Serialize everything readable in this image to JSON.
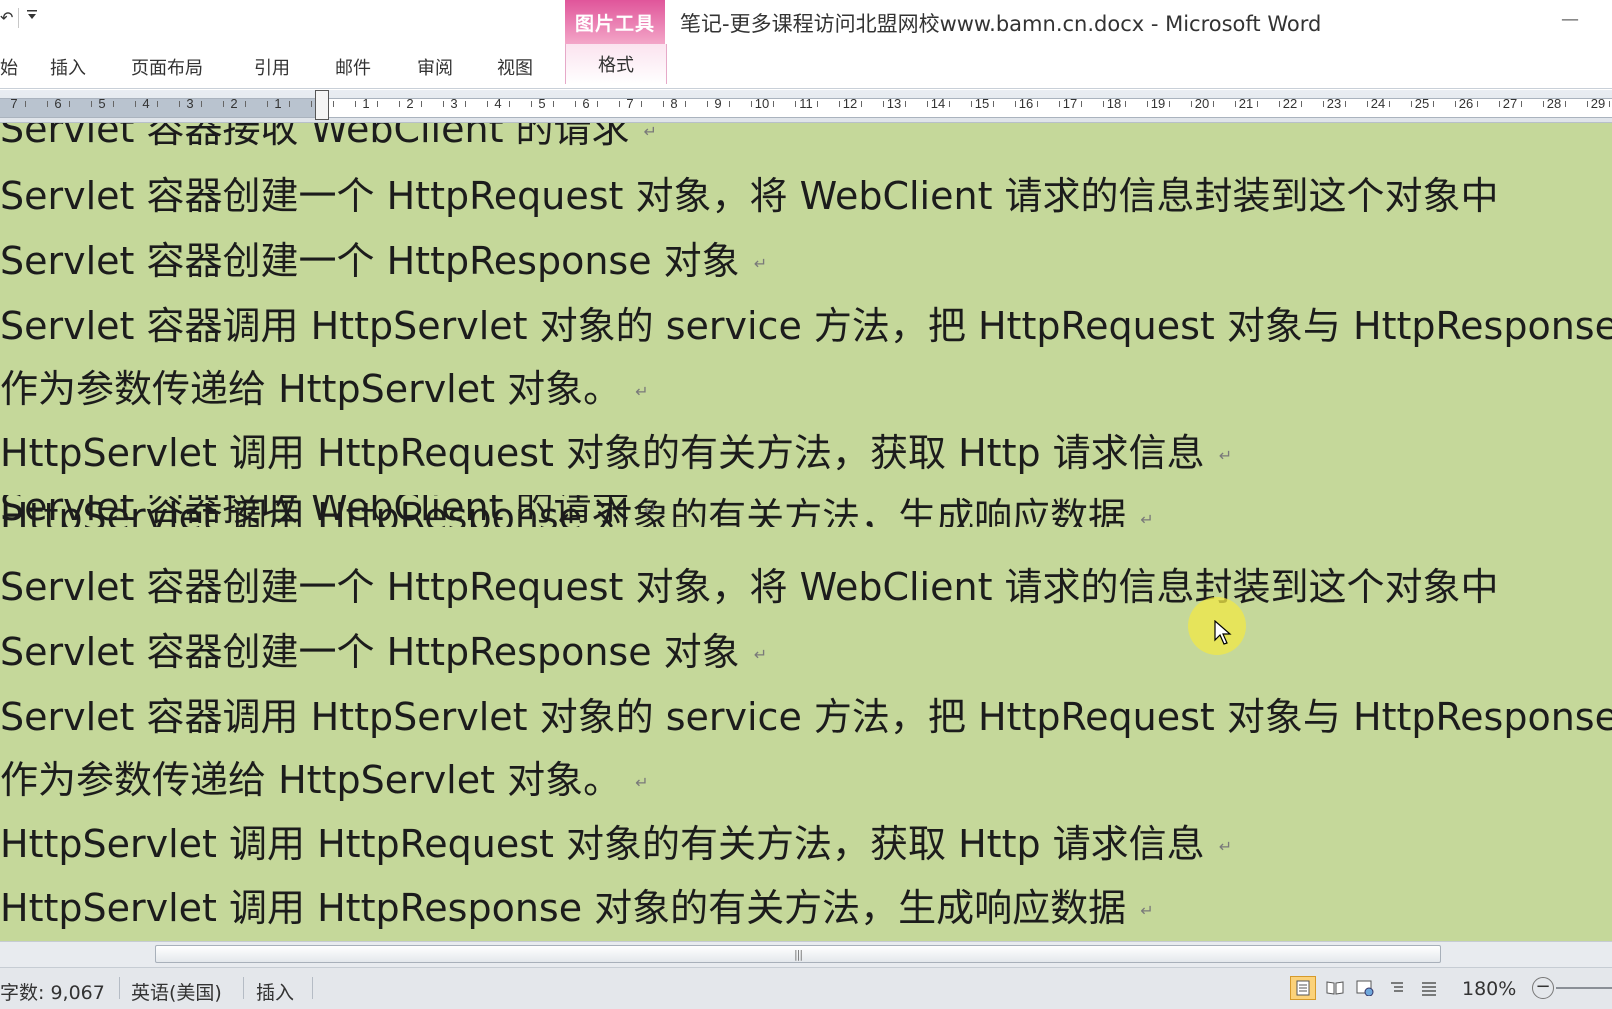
{
  "quick_access": {
    "undo_icon": "undo-icon",
    "dropdown_icon": "chevron-down-icon"
  },
  "context_tab_group": "图片工具",
  "window_title": "笔记-更多课程访问北盟网校www.bamn.cn.docx - Microsoft Word",
  "window_controls": {
    "minimize": "—"
  },
  "ribbon_tabs": [
    {
      "label": "始"
    },
    {
      "label": "插入"
    },
    {
      "label": "页面布局"
    },
    {
      "label": "引用"
    },
    {
      "label": "邮件"
    },
    {
      "label": "审阅"
    },
    {
      "label": "视图"
    },
    {
      "label": "格式",
      "contextual": true
    }
  ],
  "ruler": {
    "left_numbers": [
      "7",
      "6",
      "5",
      "4",
      "3",
      "2",
      "1"
    ],
    "right_numbers": [
      "1",
      "2",
      "3",
      "4",
      "5",
      "6",
      "7",
      "8",
      "9",
      "10",
      "11",
      "12",
      "13",
      "14",
      "15",
      "16",
      "17",
      "18",
      "19",
      "20",
      "21",
      "22",
      "23",
      "24",
      "25",
      "26",
      "27",
      "28",
      "29"
    ]
  },
  "document": {
    "background": "#c5d89a",
    "lines": [
      "Servlet 容器接收 WebClient 的请求",
      "Servlet 容器创建一个 HttpRequest 对象，将 WebClient 请求的信息封装到这个对象中",
      "Servlet 容器创建一个 HttpResponse 对象",
      "Servlet 容器调用 HttpServlet 对象的 service 方法，把 HttpRequest 对象与 HttpResponse",
      "作为参数传递给 HttpServlet 对象。",
      "HttpServlet 调用 HttpRequest 对象的有关方法，获取 Http 请求信息",
      "HttpServlet 调用 HttpResponse 对象的有关方法，生成响应数据",
      "Servlet 容器接收 WebClient 的请求",
      "Servlet 容器创建一个 HttpRequest 对象，将 WebClient 请求的信息封装到这个对象中",
      "Servlet 容器创建一个 HttpResponse 对象",
      "Servlet 容器调用 HttpServlet 对象的 service 方法，把 HttpRequest 对象与 HttpResponse",
      "作为参数传递给 HttpServlet 对象。",
      "HttpServlet 调用 HttpRequest 对象的有关方法，获取 Http 请求信息",
      "HttpServlet 调用 HttpResponse 对象的有关方法，生成响应数据"
    ],
    "paragraph_mark": "↵"
  },
  "scrollbar": {
    "grip": "|||"
  },
  "statusbar": {
    "word_count": "字数: 9,067",
    "language": "英语(美国)",
    "insert_mode": "插入",
    "zoom": "180%",
    "zoom_out": "−"
  },
  "colors": {
    "context_tab": "#e0559a",
    "status_bar": "#e4e7eb",
    "active_view": "#fbd27a"
  }
}
